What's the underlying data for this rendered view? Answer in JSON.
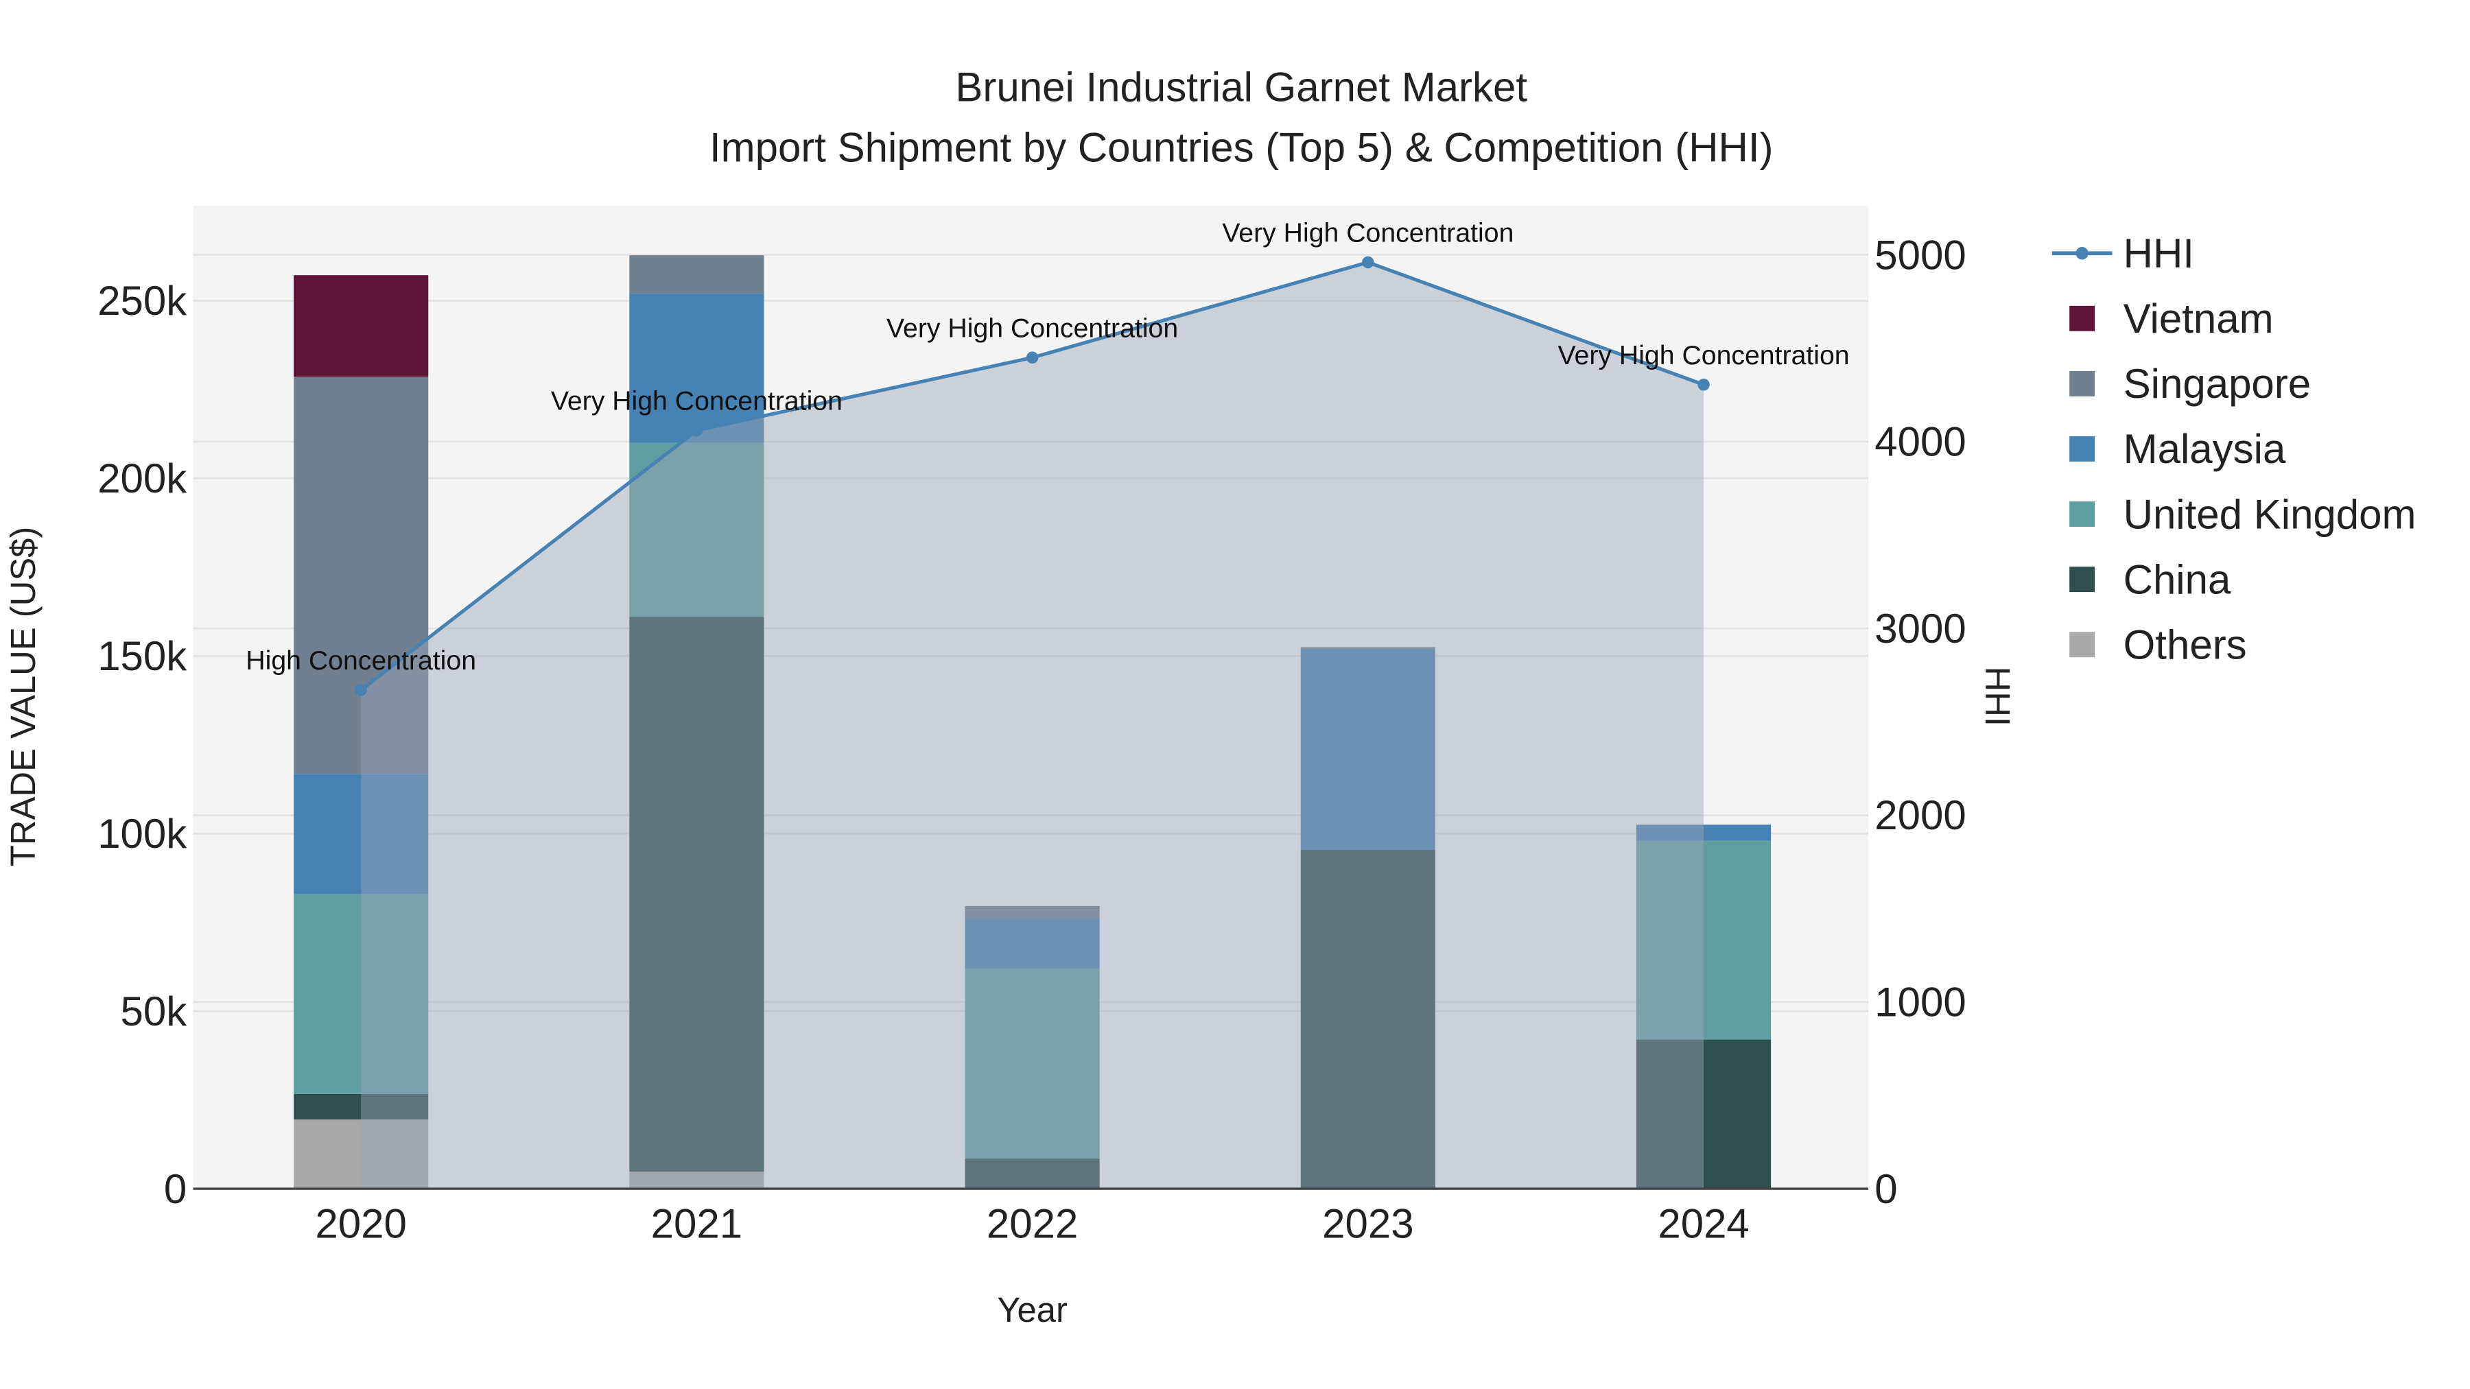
{
  "chart_data": {
    "type": "bar",
    "title": "Brunei Industrial Garnet Market",
    "subtitle": "Import Shipment by Countries (Top 5) & Competition (HHI)",
    "xlabel": "Year",
    "ylabel": "TRADE VALUE (US$)",
    "y2label": "HHI",
    "categories": [
      "2020",
      "2021",
      "2022",
      "2023",
      "2024"
    ],
    "ylim": [
      0,
      275000
    ],
    "y2lim": [
      0,
      5250
    ],
    "yticks": [
      0,
      50000,
      100000,
      150000,
      200000,
      250000
    ],
    "ytick_labels": [
      "0",
      "50k",
      "100k",
      "150k",
      "200k",
      "250k"
    ],
    "y2ticks": [
      0,
      1000,
      2000,
      3000,
      4000,
      5000
    ],
    "y2tick_labels": [
      "0",
      "1000",
      "2000",
      "3000",
      "4000",
      "5000"
    ],
    "barmode": "stack",
    "series": [
      {
        "name": "Others",
        "color": "#a9a9a9",
        "values": [
          19500,
          4800,
          0,
          0,
          0
        ]
      },
      {
        "name": "China",
        "color": "#2f4f4f",
        "values": [
          7200,
          156200,
          8500,
          95400,
          42000
        ]
      },
      {
        "name": "United Kingdom",
        "color": "#5f9ea0",
        "values": [
          56200,
          49000,
          53500,
          0,
          56000
        ]
      },
      {
        "name": "Malaysia",
        "color": "#4682b4",
        "values": [
          33900,
          42000,
          14000,
          56600,
          4500
        ]
      },
      {
        "name": "Singapore",
        "color": "#708090",
        "values": [
          111800,
          10800,
          3600,
          500,
          0
        ]
      },
      {
        "name": "Vietnam",
        "color": "#5f1535",
        "values": [
          28600,
          0,
          0,
          0,
          0
        ]
      }
    ],
    "line": {
      "name": "HHI",
      "color": "#4682b4",
      "values": [
        2670,
        4060,
        4450,
        4960,
        4305
      ],
      "annotations": [
        "High Concentration",
        "Very High Concentration",
        "Very High Concentration",
        "Very High Concentration",
        "Very High Concentration"
      ]
    },
    "legend": [
      "HHI",
      "Vietnam",
      "Singapore",
      "Malaysia",
      "United Kingdom",
      "China",
      "Others"
    ],
    "legend_position": "right",
    "grid": true
  }
}
